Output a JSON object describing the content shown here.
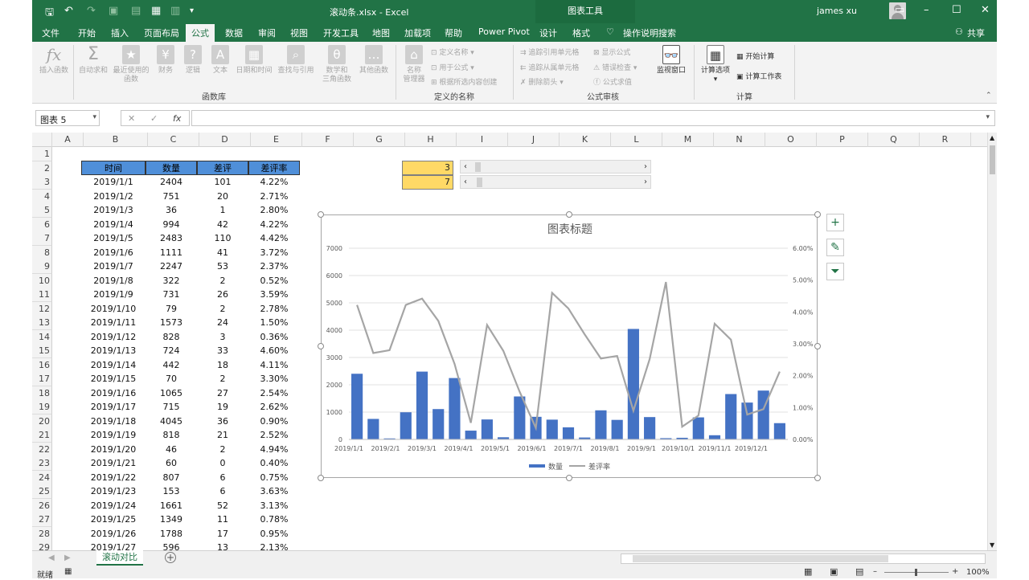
{
  "titlebar": {
    "filename": "滚动条.xlsx",
    "sep": "-",
    "app": "Excel",
    "context_tab": "图表工具",
    "user": "james xu"
  },
  "tabs": [
    "文件",
    "开始",
    "插入",
    "页面布局",
    "公式",
    "数据",
    "审阅",
    "视图",
    "开发工具",
    "地图",
    "加载项",
    "帮助",
    "Power Pivot",
    "设计",
    "格式"
  ],
  "active_tab": "公式",
  "tell_me": "操作说明搜索",
  "share": "共享",
  "ribbon": {
    "func_buttons": [
      {
        "label": "插入函数",
        "icon": "fx-icon"
      },
      {
        "label": "自动求和",
        "icon": "sigma-icon"
      },
      {
        "label": "最近使用的",
        "label2": "函数",
        "icon": "star-icon"
      },
      {
        "label": "财务",
        "icon": "finance-icon"
      },
      {
        "label": "逻辑",
        "icon": "logic-icon"
      },
      {
        "label": "文本",
        "icon": "text-icon"
      },
      {
        "label": "日期和时间",
        "icon": "clock-icon"
      },
      {
        "label": "查找与引用",
        "icon": "search-icon"
      },
      {
        "label": "数学和",
        "label2": "三角函数",
        "icon": "math-icon"
      },
      {
        "label": "其他函数",
        "icon": "more-icon"
      }
    ],
    "group_library": "函数库",
    "name_manager": "名称",
    "name_manager2": "管理器",
    "define_name": "定义名称",
    "use_in_formula": "用于公式",
    "create_from_sel": "根据所选内容创建",
    "group_names": "定义的名称",
    "trace_precedents": "追踪引用单元格",
    "trace_dependents": "追踪从属单元格",
    "remove_arrows": "删除箭头",
    "show_formulas": "显示公式",
    "error_check": "错误检查",
    "eval_formula": "公式求值",
    "watch_window": "监视窗口",
    "group_audit": "公式审核",
    "calc_options": "计算选项",
    "calc_now": "开始计算",
    "calc_sheet": "计算工作表",
    "group_calc": "计算"
  },
  "namebox": "图表 5",
  "columns": [
    "A",
    "B",
    "C",
    "D",
    "E",
    "F",
    "G",
    "H",
    "I",
    "J",
    "K",
    "L",
    "M",
    "N",
    "O",
    "P",
    "Q",
    "R"
  ],
  "table": {
    "headers": [
      "时间",
      "数量",
      "差评",
      "差评率"
    ],
    "rows": [
      [
        "2019/1/1",
        "2404",
        "101",
        "4.22%"
      ],
      [
        "2019/1/2",
        "751",
        "20",
        "2.71%"
      ],
      [
        "2019/1/3",
        "36",
        "1",
        "2.80%"
      ],
      [
        "2019/1/4",
        "994",
        "42",
        "4.22%"
      ],
      [
        "2019/1/5",
        "2483",
        "110",
        "4.42%"
      ],
      [
        "2019/1/6",
        "1111",
        "41",
        "3.72%"
      ],
      [
        "2019/1/7",
        "2247",
        "53",
        "2.37%"
      ],
      [
        "2019/1/8",
        "322",
        "2",
        "0.52%"
      ],
      [
        "2019/1/9",
        "731",
        "26",
        "3.59%"
      ],
      [
        "2019/1/10",
        "79",
        "2",
        "2.78%"
      ],
      [
        "2019/1/11",
        "1573",
        "24",
        "1.50%"
      ],
      [
        "2019/1/12",
        "828",
        "3",
        "0.36%"
      ],
      [
        "2019/1/13",
        "724",
        "33",
        "4.60%"
      ],
      [
        "2019/1/14",
        "442",
        "18",
        "4.11%"
      ],
      [
        "2019/1/15",
        "70",
        "2",
        "3.30%"
      ],
      [
        "2019/1/16",
        "1065",
        "27",
        "2.54%"
      ],
      [
        "2019/1/17",
        "715",
        "19",
        "2.62%"
      ],
      [
        "2019/1/18",
        "4045",
        "36",
        "0.90%"
      ],
      [
        "2019/1/19",
        "818",
        "21",
        "2.52%"
      ],
      [
        "2019/1/20",
        "46",
        "2",
        "4.94%"
      ],
      [
        "2019/1/21",
        "60",
        "0",
        "0.40%"
      ],
      [
        "2019/1/22",
        "807",
        "6",
        "0.75%"
      ],
      [
        "2019/1/23",
        "153",
        "6",
        "3.63%"
      ],
      [
        "2019/1/24",
        "1661",
        "52",
        "3.13%"
      ],
      [
        "2019/1/25",
        "1349",
        "11",
        "0.78%"
      ],
      [
        "2019/1/26",
        "1788",
        "17",
        "0.95%"
      ],
      [
        "2019/1/27",
        "596",
        "13",
        "2.13%"
      ]
    ]
  },
  "scroll_values": [
    "3",
    "7"
  ],
  "chart_data": {
    "type": "bar",
    "title": "图表标题",
    "x_ticks": [
      "2019/1/1",
      "2019/2/1",
      "2019/3/1",
      "2019/4/1",
      "2019/5/1",
      "2019/6/1",
      "2019/7/1",
      "2019/8/1",
      "2019/9/1",
      "2019/10/1",
      "2019/11/1",
      "2019/12/1"
    ],
    "y_ticks": [
      "0",
      "1000",
      "2000",
      "3000",
      "4000",
      "5000",
      "6000",
      "7000"
    ],
    "y2_ticks": [
      "0.00%",
      "1.00%",
      "2.00%",
      "3.00%",
      "4.00%",
      "5.00%",
      "6.00%"
    ],
    "ylim": [
      0,
      7000
    ],
    "y2lim": [
      0,
      6
    ],
    "series": [
      {
        "name": "数量",
        "kind": "bar",
        "color": "#4472c4",
        "values": [
          2404,
          751,
          36,
          994,
          2483,
          1111,
          2247,
          322,
          731,
          79,
          1573,
          828,
          724,
          442,
          70,
          1065,
          715,
          4045,
          818,
          46,
          60,
          807,
          153,
          1661,
          1349,
          1788,
          596
        ]
      },
      {
        "name": "差评率",
        "kind": "line",
        "color": "#a5a5a5",
        "values": [
          4.22,
          2.71,
          2.8,
          4.22,
          4.42,
          3.72,
          2.37,
          0.52,
          3.59,
          2.78,
          1.5,
          0.36,
          4.6,
          4.11,
          3.3,
          2.54,
          2.62,
          0.9,
          2.52,
          4.94,
          0.4,
          0.75,
          3.63,
          3.13,
          0.78,
          0.95,
          2.13
        ]
      }
    ],
    "legend": "bottom"
  },
  "sheet_tab": "滚动对比",
  "status": "就绪",
  "zoom": "100%"
}
